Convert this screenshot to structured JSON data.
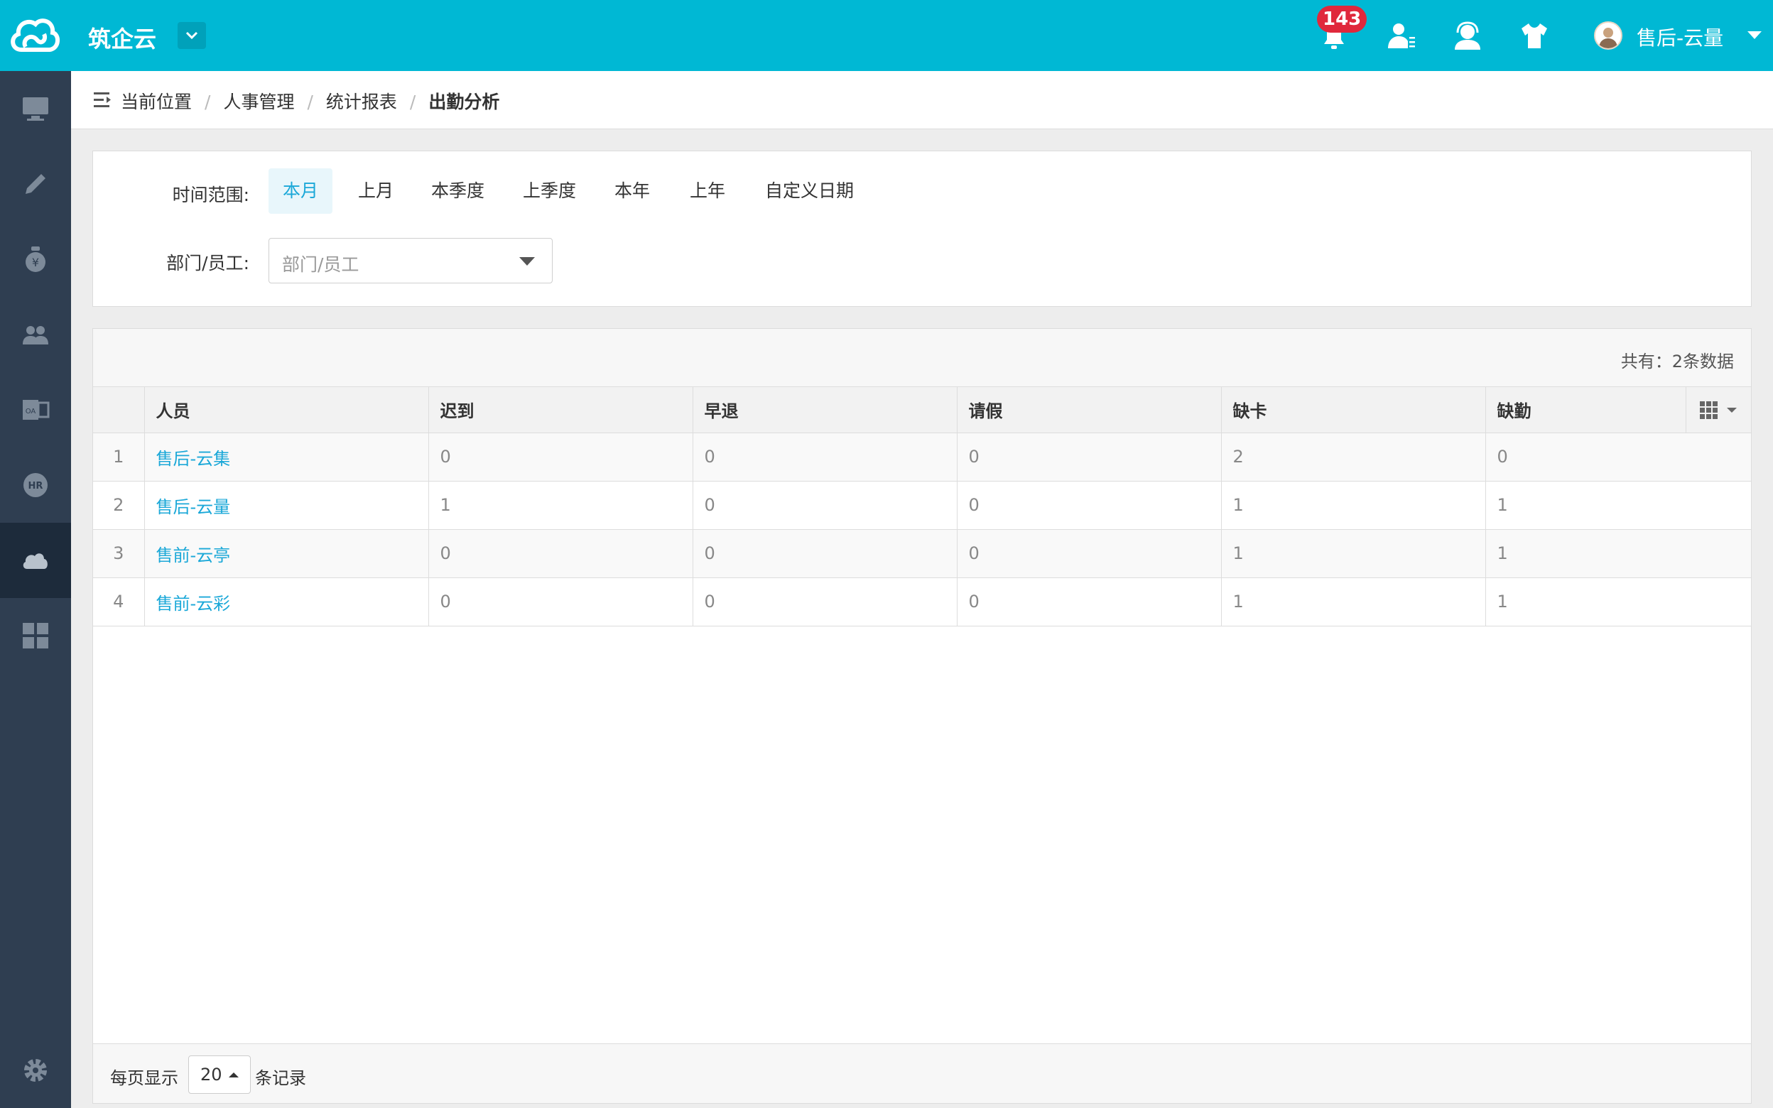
{
  "header": {
    "brand": "筑企云",
    "notification_count": "143",
    "user_name": "售后-云量"
  },
  "breadcrumb": {
    "items": [
      "当前位置",
      "人事管理",
      "统计报表",
      "出勤分析"
    ],
    "separator": "/"
  },
  "filter": {
    "range_label": "时间范围:",
    "ranges": [
      "本月",
      "上月",
      "本季度",
      "上季度",
      "本年",
      "上年",
      "自定义日期"
    ],
    "active_range": "本月",
    "dept_label": "部门/员工:",
    "dept_placeholder": "部门/员工"
  },
  "table": {
    "total_text": "共有：2条数据",
    "columns": [
      "人员",
      "迟到",
      "早退",
      "请假",
      "缺卡",
      "缺勤"
    ],
    "rows": [
      {
        "index": "1",
        "name": "售后-云集",
        "late": "0",
        "early": "0",
        "leave": "0",
        "missing_card": "2",
        "absent": "0"
      },
      {
        "index": "2",
        "name": "售后-云量",
        "late": "1",
        "early": "0",
        "leave": "0",
        "missing_card": "1",
        "absent": "1"
      },
      {
        "index": "3",
        "name": "售前-云亭",
        "late": "0",
        "early": "0",
        "leave": "0",
        "missing_card": "1",
        "absent": "1"
      },
      {
        "index": "4",
        "name": "售前-云彩",
        "late": "0",
        "early": "0",
        "leave": "0",
        "missing_card": "1",
        "absent": "1"
      }
    ]
  },
  "pagination": {
    "per_page_label": "每页显示",
    "per_page_value": "20",
    "records_label": "条记录"
  },
  "icons": {
    "sidebar": [
      "monitor-icon",
      "pencil-icon",
      "money-bag-icon",
      "users-icon",
      "office-icon",
      "hr-icon",
      "cloud-icon",
      "dashboard-icon",
      "settings-icon"
    ],
    "top": [
      "bell-icon",
      "contact-icon",
      "support-icon",
      "shirt-icon"
    ]
  },
  "colors": {
    "topbar": "#00b8d4",
    "sidebar": "#2f3e51",
    "link": "#1ba8d8",
    "badge": "#e0283c"
  }
}
